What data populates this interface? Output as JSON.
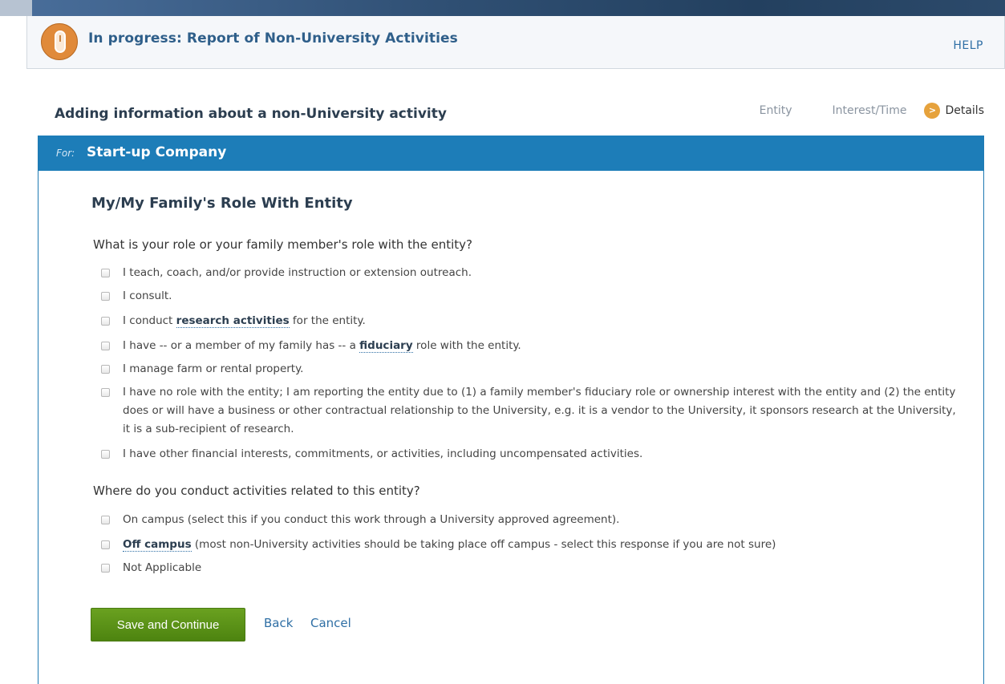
{
  "header": {
    "title": "In progress: Report of Non-University Activities",
    "help": "HELP"
  },
  "subtitle": "Adding information about a non-University activity",
  "steps": [
    {
      "label": "Entity",
      "active": false
    },
    {
      "label": "Interest/Time",
      "active": false
    },
    {
      "label": "Details",
      "active": true
    }
  ],
  "panel": {
    "for_label": "For:",
    "for_value": "Start-up Company"
  },
  "section_title": "My/My Family's Role With Entity",
  "question1": {
    "text": "What is your role or your family member's role with the entity?",
    "options": [
      {
        "text": "I teach, coach, and/or provide instruction or extension outreach."
      },
      {
        "text": "I consult."
      },
      {
        "pre": "I conduct ",
        "term": "research activities",
        "post": " for the entity."
      },
      {
        "pre": "I have -- or a member of my family has -- a ",
        "term": "fiduciary",
        "post": " role with the entity."
      },
      {
        "text": "I manage farm or rental property."
      },
      {
        "text": "I have no role with the entity; I am reporting the entity due to (1) a family member's fiduciary role or ownership interest with the entity and (2) the entity does or will have a business or other contractual relationship to the University, e.g. it is a vendor to the University, it sponsors research at the University, it is a sub-recipient of research."
      },
      {
        "text": "I have other financial interests, commitments, or activities, including uncompensated activities."
      }
    ]
  },
  "question2": {
    "text": "Where do you conduct activities related to this entity?",
    "options": [
      {
        "text": "On campus (select this if you conduct this work through a University approved agreement)."
      },
      {
        "term": "Off campus",
        "post": " (most non-University activities should be taking place off campus - select this response if you are not sure)"
      },
      {
        "text": "Not Applicable"
      }
    ]
  },
  "actions": {
    "save": "Save and Continue",
    "back": "Back",
    "cancel": "Cancel"
  },
  "colors": {
    "header_title": "#2f5f8a",
    "panel_header": "#1d7db8",
    "save_button": "#5a931a",
    "link": "#2f6fa5",
    "step_icon": "#e6a23c",
    "progress_icon": "#e08a3a"
  },
  "icons": {
    "progress": "mouse-icon",
    "step_active": "chevron-right-circle-icon"
  }
}
